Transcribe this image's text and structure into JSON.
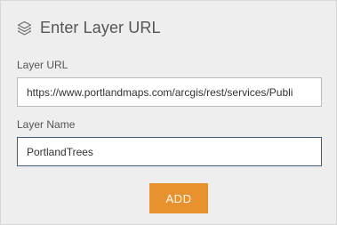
{
  "header": {
    "icon": "layers-icon",
    "title": "Enter Layer URL"
  },
  "form": {
    "url_label": "Layer URL",
    "url_value": "https://www.portlandmaps.com/arcgis/rest/services/Publi",
    "name_label": "Layer Name",
    "name_value": "PortlandTrees"
  },
  "actions": {
    "add_label": "ADD"
  },
  "colors": {
    "panel_bg": "#eeeeee",
    "accent": "#e8912f",
    "focus_border": "#3f5e7f",
    "text": "#555555"
  }
}
